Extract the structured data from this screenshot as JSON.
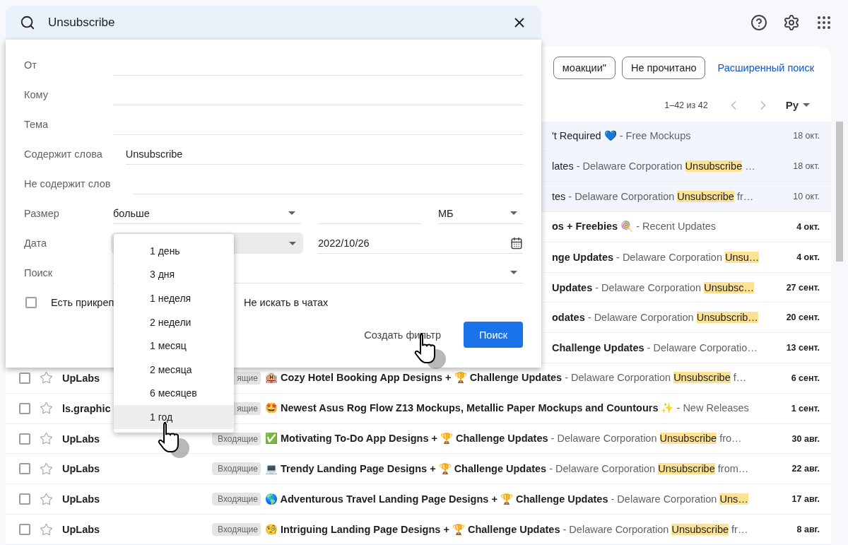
{
  "search": {
    "value": "Unsubscribe"
  },
  "chips": [
    {
      "label": "моакции\""
    },
    {
      "label": "Не прочитано"
    }
  ],
  "advanced_link": "Расширенный поиск",
  "pagination": {
    "range": "1–42 из 42",
    "language": "Ру"
  },
  "emails": [
    {
      "subject": "'t Required 💙",
      "snippet": " - Free Mockups",
      "date": "18 окт.",
      "unread": false
    },
    {
      "subject": "lates",
      "snippet": " - Delaware Corporation ",
      "highlight": "Unsubscribe",
      "rest": " …",
      "date": "18 окт.",
      "unread": false
    },
    {
      "subject": "tes",
      "snippet": " - Delaware Corporation ",
      "highlight": "Unsubscribe",
      "rest": " fr…",
      "date": "10 окт.",
      "unread": false
    },
    {
      "subject": "os + Freebies 🍭",
      "snippet": " - Recent Updates",
      "date": "4 окт.",
      "unread": true
    },
    {
      "subject": "nge Updates",
      "snippet": " - Delaware Corporation ",
      "highlight": "Unsu…",
      "date": "4 окт.",
      "unread": true
    },
    {
      "subject": "Updates",
      "snippet": " - Delaware Corporation ",
      "highlight": "Unsubsc…",
      "date": "27 сент.",
      "unread": true
    },
    {
      "subject": "odates",
      "snippet": " - Delaware Corporation ",
      "highlight": "Unsubscrib…",
      "date": "20 сент.",
      "unread": true
    },
    {
      "subject": "Challenge Updates",
      "snippet": " - Delaware Corporatio…",
      "date": "13 сент.",
      "unread": true
    },
    {
      "sender": "UpLabs",
      "label": "ящие",
      "subject": "🏨 Cozy Hotel Booking App Designs + 🏆 Challenge Updates",
      "snippet": " - Delaware Corporation ",
      "highlight": "Unsubscribe",
      "rest": " f…",
      "date": "6 сент.",
      "unread": true
    },
    {
      "sender": "ls.graphic",
      "label": "ящие",
      "subject": "🤩 Newest Asus Rog Flow Z13 Mockups, Metallic Paper Mockups and Countours ✨",
      "snippet": " - New Releases",
      "date": "1 сент.",
      "unread": true
    },
    {
      "sender": "UpLabs",
      "label": "Входящие",
      "subject": "✅ Motivating To-Do App Designs + 🏆 Challenge Updates",
      "snippet": " - Delaware Corporation ",
      "highlight": "Unsubscribe",
      "rest": " fro…",
      "date": "30 авг.",
      "unread": true
    },
    {
      "sender": "UpLabs",
      "label": "Входящие",
      "subject": "💻 Trendy Landing Page Designs + 🏆 Challenge Updates",
      "snippet": " - Delaware Corporation ",
      "highlight": "Unsubscribe",
      "rest": " from…",
      "date": "22 авг.",
      "unread": true
    },
    {
      "sender": "UpLabs",
      "label": "Входящие",
      "subject": "🌎 Adventurous Travel Landing Page Designs + 🏆 Challenge Updates",
      "snippet": " - Delaware Corporation ",
      "highlight": "Uns…",
      "date": "17 авг.",
      "unread": true
    },
    {
      "sender": "UpLabs",
      "label": "Входящие",
      "subject": "🧐 Intriguing Landing Page Designs + 🏆 Challenge Updates",
      "snippet": " - Delaware Corporation ",
      "highlight": "Unsubscribe",
      "rest": " fr…",
      "date": "8 авг.",
      "unread": true
    }
  ],
  "advanced_search": {
    "fields": [
      {
        "label": "От"
      },
      {
        "label": "Кому"
      },
      {
        "label": "Тема"
      },
      {
        "label": "Содержит слова",
        "value": "Unsubscribe"
      },
      {
        "label": "Не содержит слов"
      }
    ],
    "size": {
      "label": "Размер",
      "operator": "больше",
      "unit": "МБ"
    },
    "date": {
      "label": "Дата",
      "open": true,
      "value": "2022/10/26",
      "options": [
        {
          "label": "1 день",
          "selected": false
        },
        {
          "label": "3 дня",
          "selected": false
        },
        {
          "label": "1 неделя",
          "selected": false
        },
        {
          "label": "2 недели",
          "selected": false
        },
        {
          "label": "1 месяц",
          "selected": false
        },
        {
          "label": "2 месяца",
          "selected": false
        },
        {
          "label": "6 месяцев",
          "selected": false
        },
        {
          "label": "1 год",
          "selected": true
        }
      ]
    },
    "scope": {
      "label": "Поиск"
    },
    "checkboxes": [
      {
        "label": "Есть прикреп",
        "checked": false
      },
      {
        "label": "Не искать в чатах"
      }
    ],
    "create_filter": "Создать фильтр",
    "submit": "Поиск"
  }
}
